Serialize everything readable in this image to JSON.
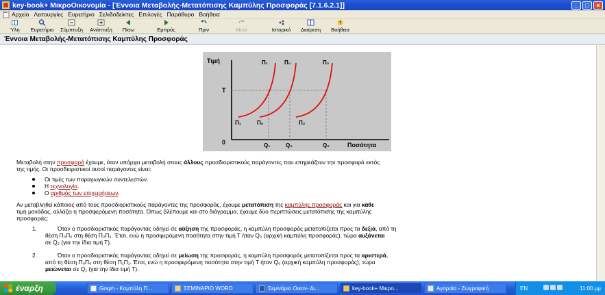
{
  "window": {
    "title": "key-book+  ΜικροΟικονομία - [Έννοια Μεταβολής-Μετατόπισης Καμπύλης Προσφοράς  [7.1.6.2.1]]"
  },
  "menu": [
    "Αρχείο",
    "Λειτουργίες",
    "Ευρετήριο",
    "Σελιδοδείκτες",
    "Επιλογές",
    "Παράθυρο",
    "Βοήθεια"
  ],
  "toolbar": {
    "items": [
      {
        "label": "Ύλη",
        "icon": "book-icon"
      },
      {
        "label": "Ευρετήριο",
        "icon": "magnifier-icon"
      },
      {
        "label": "Σύμπτυξη",
        "icon": "collapse-icon"
      },
      {
        "label": "Ανάπτυξη",
        "icon": "expand-icon"
      },
      {
        "label": "Πίσω",
        "icon": "back-arrow-icon"
      },
      {
        "label": "Εμπρός",
        "icon": "forward-arrow-icon"
      },
      {
        "label": "Πριν",
        "icon": "undo-icon"
      },
      {
        "label": "Μετά",
        "icon": "redo-icon"
      },
      {
        "label": "Ιστορικό",
        "icon": "history-icon"
      },
      {
        "label": "Διαίρεση",
        "icon": "split-icon"
      },
      {
        "label": "Βοήθεια",
        "icon": "help-icon"
      }
    ]
  },
  "page": {
    "heading": "Έννοια Μεταβολής-Μετατόπισης Καμπύλης Προσφοράς"
  },
  "figure": {
    "y_label": "Τιμή",
    "x_label": "Ποσότητα",
    "price_mark": "Τ",
    "origin": "0",
    "curve_top_labels": [
      "Π₁",
      "Π₀",
      "Π₂"
    ],
    "curve_bottom_labels": [
      "Π₁",
      "Π₀",
      "Π₂"
    ],
    "q_labels": [
      "Q₁",
      "Q₀",
      "Q₂"
    ],
    "colors": {
      "curve": "#e01010",
      "bg": "#c8c8c8"
    }
  },
  "content": {
    "p1_a": "Μεταβολή στην ",
    "p1_link": "προσφορά",
    "p1_b": " έχουμε, όταν υπάρχει μεταβολή στους ",
    "p1_bold": "άλλους",
    "p1_c": " προσδιοριστικούς παράγοντες που επηρεάζουν την προσφορά εκτός",
    "p1_line2": "της τιμής. Οι προσδιοριστικοί αυτοί παράγοντες είναι:",
    "bullets": {
      "b1": "Οι τιμές των παραγωγικών συντελεστών.",
      "b2_a": "Η ",
      "b2_link": "τεχνολογία",
      "b2_b": ".",
      "b3_a": "Ο ",
      "b3_link": "αριθμός των επιχειρήσεων",
      "b3_b": "."
    },
    "p2_a": "Αν μεταβληθεί κάποιος από τους προσδιοριστικούς παράγοντες της προσφοράς, έχουμε ",
    "p2_bold": "μετατόπιση",
    "p2_b": " της ",
    "p2_link": "καμπύλης προσφοράς",
    "p2_c": " και για ",
    "p2_bold2": "κάθε",
    "p2_line2": "τιμή μονάδας, αλλάζει η προσφερόμενη ποσότητα. Όπως βλέπουμε και στο διάγραμμα, έχουμε δύο περιπτώσεις μετατόπισης της καμπύλης",
    "p2_line3": "προσφοράς:",
    "n1": {
      "num": "1.",
      "a": "Όταν ο προσδιοριστικός παράγοντας οδηγεί σε ",
      "bold1": "αύξηση",
      "b": " της προσφοράς, η καμπύλη προσφοράς μετατοπίζεται προς τα ",
      "bold2": "δεξιά",
      "c": ", από τη",
      "line2": "θέση Π₀Π₀ στη θέση Π₂Π₂. Έτσι, ενώ η προσφερόμενη ποσότητα στην τιμή Τ ήταν Q₀ (αρχική καμπύλη προσφοράς), τώρα ",
      "bold3": "αυξάνεται",
      "line3": "σε Q₂ (για την ίδια τιμή Τ)."
    },
    "n2": {
      "num": "2.",
      "a": "Όταν ο προσδιοριστικός παράγοντας οδηγεί σε ",
      "bold1": "μείωση",
      "b": " της προσφοράς, η καμπύλη προσφοράς μετατοπίζεται προς τα ",
      "bold2": "αριστερά",
      "c": ",",
      "line2": "από τη θέση Π₀Π₀ στη θέση Π₁Π₁. Έτσι, ενώ η προσφερόμενη ποσότητα στην τιμή Τ ήταν Q₀ (αρχική καμπύλη προσφοράς), τώρα",
      "bold3": "μειώνεται",
      "line3": " σε Q₁ (για την ίδια τιμή Τ)."
    }
  },
  "taskbar": {
    "start": "έναρξη",
    "tasks": [
      "Graph - Καμπύλη Π...",
      "ΣΕΜΙΝΑΡΙΟ WORD",
      "Σεμινάριο Οικον- Δι...",
      "key-book+  Μικρο...",
      "Αγοραία - Ζωγραφική"
    ],
    "lang": "EN",
    "clock": "11:00 μμ"
  }
}
